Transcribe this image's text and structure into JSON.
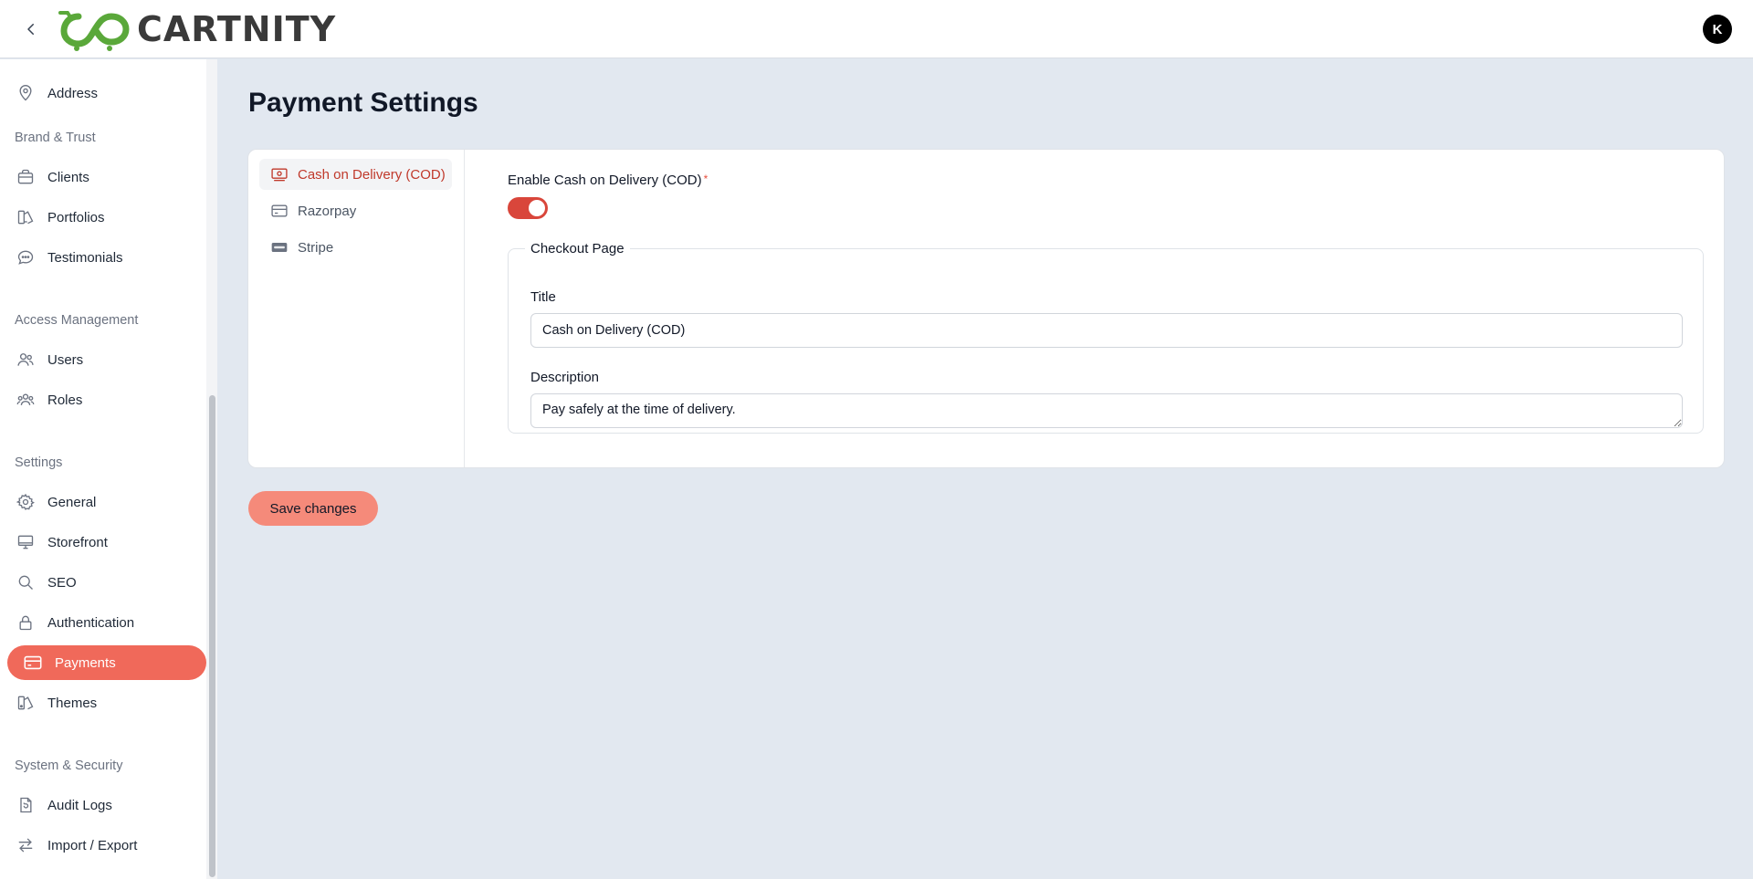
{
  "header": {
    "brand": "CARTNITY",
    "avatar_initial": "K"
  },
  "sidebar": {
    "items_top": [
      {
        "label": "Address",
        "icon": "map-pin-icon"
      }
    ],
    "sections": [
      {
        "label": "Brand & Trust",
        "items": [
          {
            "label": "Clients",
            "icon": "briefcase-icon"
          },
          {
            "label": "Portfolios",
            "icon": "portfolio-icon"
          },
          {
            "label": "Testimonials",
            "icon": "chat-bubble-icon"
          }
        ]
      },
      {
        "label": "Access Management",
        "items": [
          {
            "label": "Users",
            "icon": "users-icon"
          },
          {
            "label": "Roles",
            "icon": "roles-icon"
          }
        ]
      },
      {
        "label": "Settings",
        "items": [
          {
            "label": "General",
            "icon": "gear-icon"
          },
          {
            "label": "Storefront",
            "icon": "monitor-icon"
          },
          {
            "label": "SEO",
            "icon": "search-icon"
          },
          {
            "label": "Authentication",
            "icon": "lock-icon"
          },
          {
            "label": "Payments",
            "icon": "credit-card-icon",
            "active": true
          },
          {
            "label": "Themes",
            "icon": "palette-icon"
          }
        ]
      },
      {
        "label": "System & Security",
        "items": [
          {
            "label": "Audit Logs",
            "icon": "audit-log-icon"
          },
          {
            "label": "Import / Export",
            "icon": "swap-arrows-icon"
          }
        ]
      }
    ]
  },
  "main": {
    "title": "Payment Settings",
    "methods": [
      {
        "label": "Cash on Delivery (COD)",
        "icon": "cash-icon",
        "active": true
      },
      {
        "label": "Razorpay",
        "icon": "card-icon"
      },
      {
        "label": "Stripe",
        "icon": "stripe-icon"
      }
    ],
    "toggle": {
      "label": "Enable Cash on Delivery (COD)",
      "required_mark": "*",
      "enabled": true
    },
    "checkout": {
      "legend": "Checkout Page",
      "title_label": "Title",
      "title_value": "Cash on Delivery (COD)",
      "description_label": "Description",
      "description_value": "Pay safely at the time of delivery."
    },
    "save_label": "Save changes"
  },
  "colors": {
    "accent": "#f0695a",
    "toggle_on": "#d9463b",
    "save_button": "#f58a7a",
    "active_method_text": "#c0392b",
    "brand_green": "#5aa83a"
  }
}
